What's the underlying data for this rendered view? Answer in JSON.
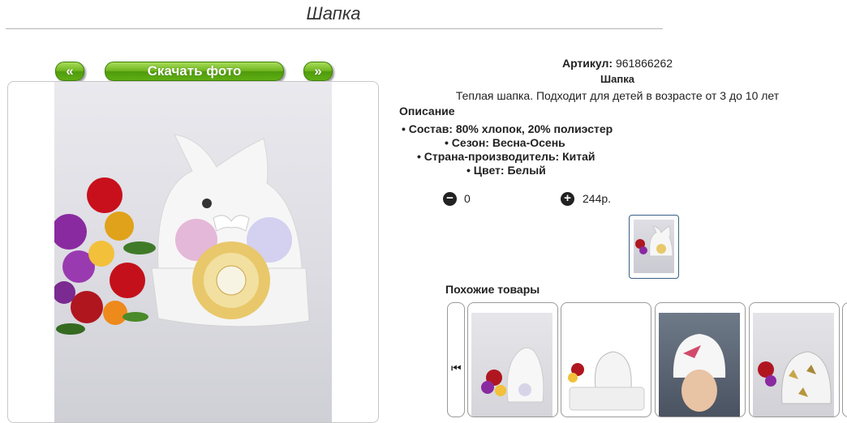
{
  "page": {
    "title": "Шапка"
  },
  "gallery": {
    "prev_label": "«",
    "download_label": "Скачать фото",
    "next_label": "»"
  },
  "product": {
    "article_label": "Артикул:",
    "article_value": "961866262",
    "name": "Шапка",
    "description": "Теплая шапка. Подходит для детей в возрасте от 3 до 10 лет",
    "description_heading": "Описание",
    "properties": [
      "• Состав: 80% хлопок, 20% полиэстер",
      "• Сезон: Весна-Осень",
      "• Страна-производитель: Китай",
      "• Цвет: Белый"
    ],
    "quantity": "0",
    "price": "244р."
  },
  "icons": {
    "minus": "minus-circle-icon",
    "plus": "plus-circle-icon",
    "slider_prev": "skip-back-icon"
  },
  "similar": {
    "heading": "Похожие товары"
  },
  "colors": {
    "button_green": "#6fb51e",
    "thumb_border": "#3a5f85"
  }
}
